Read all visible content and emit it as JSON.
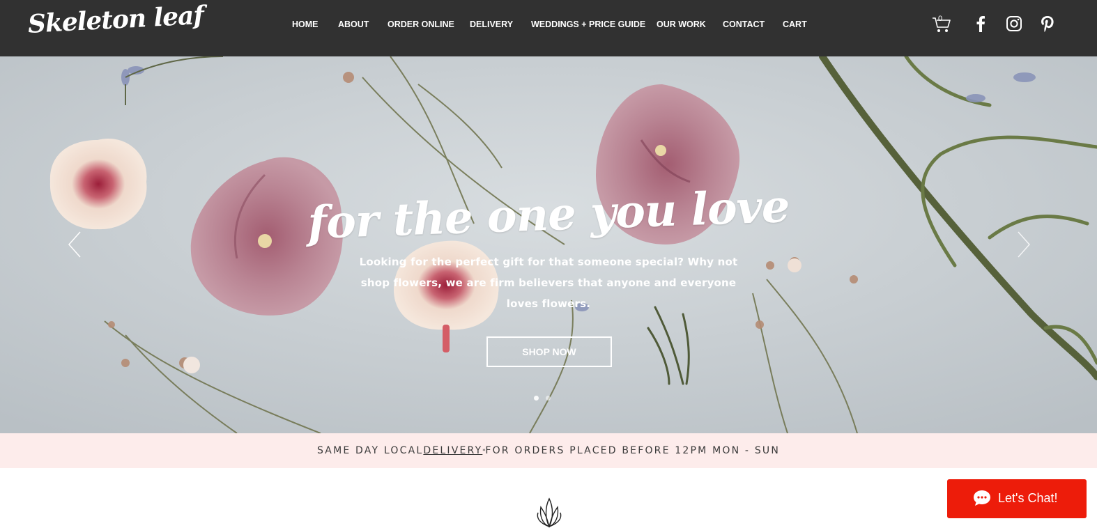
{
  "header": {
    "logo": "Skeleton leaf",
    "nav": [
      {
        "label": "HOME"
      },
      {
        "label": "ABOUT"
      },
      {
        "label": "ORDER ONLINE"
      },
      {
        "label": "DELIVERY"
      },
      {
        "label": "WEDDINGS + PRICE GUIDE"
      },
      {
        "label": "OUR WORK"
      },
      {
        "label": "CONTACT"
      },
      {
        "label": "CART"
      }
    ],
    "cart_count": "0",
    "icons": [
      "cart-icon",
      "facebook-icon",
      "instagram-icon",
      "pinterest-icon"
    ]
  },
  "hero": {
    "title": "for the one you love",
    "text": "Looking for the perfect gift for that someone special? Why not shop flowers, we are firm believers that anyone and everyone loves flowers.",
    "button": "SHOP NOW",
    "slides": 2,
    "active_slide": 1
  },
  "banner": {
    "before": "SAME DAY LOCAL ",
    "link": "DELIVERY",
    "mark": "*",
    "after": " FOR ORDERS PLACED BEFORE 12PM MON - SUN"
  },
  "chat": {
    "label": "Let's Chat!"
  },
  "colors": {
    "header_bg": "#313131",
    "banner_bg": "#fdeceb",
    "chat_bg": "#ed1c0a",
    "hero_bg": "#c6ccd0"
  }
}
